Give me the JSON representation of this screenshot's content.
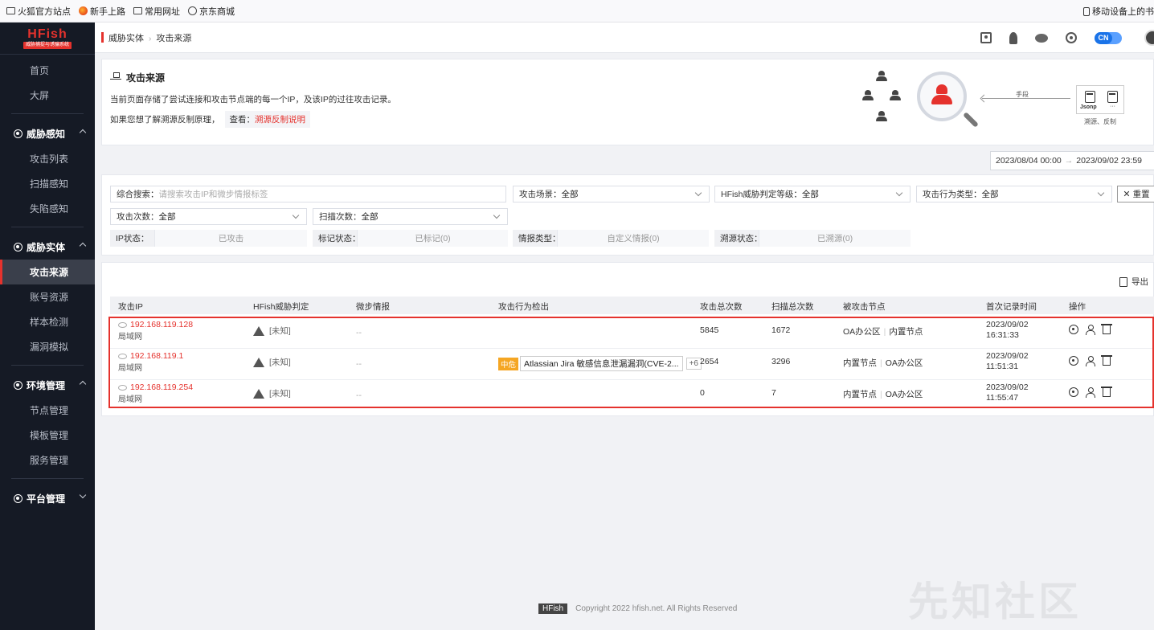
{
  "browser": {
    "bookmarks": [
      {
        "label": "火狐官方站点",
        "icon": "folder-icon"
      },
      {
        "label": "新手上路",
        "icon": "firefox-icon"
      },
      {
        "label": "常用网址",
        "icon": "folder-icon"
      },
      {
        "label": "京东商城",
        "icon": "globe-icon"
      }
    ],
    "mobile_bookmarks": "移动设备上的书"
  },
  "app": {
    "logo_title": "HFish",
    "logo_subtitle": "威胁捕捉与诱骗系统"
  },
  "sidebar": {
    "top_items": [
      {
        "label": "首页"
      },
      {
        "label": "大屏"
      }
    ],
    "groups": [
      {
        "label": "威胁感知",
        "expanded": true,
        "items": [
          {
            "label": "攻击列表"
          },
          {
            "label": "扫描感知"
          },
          {
            "label": "失陷感知"
          }
        ]
      },
      {
        "label": "威胁实体",
        "expanded": true,
        "items": [
          {
            "label": "攻击来源",
            "active": true
          },
          {
            "label": "账号资源"
          },
          {
            "label": "样本检测"
          },
          {
            "label": "漏洞模拟"
          }
        ]
      },
      {
        "label": "环境管理",
        "expanded": true,
        "items": [
          {
            "label": "节点管理"
          },
          {
            "label": "模板管理"
          },
          {
            "label": "服务管理"
          }
        ]
      },
      {
        "label": "平台管理",
        "expanded": false,
        "items": []
      }
    ]
  },
  "header": {
    "breadcrumb": [
      "威胁实体",
      "攻击来源"
    ],
    "lang": "CN",
    "icons": [
      "book-icon",
      "rocket-icon",
      "wechat-icon",
      "shield-icon",
      "avatar"
    ]
  },
  "intro": {
    "title": "攻击来源",
    "description": "当前页面存储了尝试连接和攻击节点端的每一个IP，及该IP的过往攻击记录。",
    "more_prefix": "如果您想了解溯源反制原理，",
    "more_view": "查看：",
    "more_link": "溯源反制说明",
    "illustration": {
      "arrow_label": "手段",
      "method1": "Jsonp",
      "method2": "···",
      "caption": "溯源、反制"
    }
  },
  "daterange": {
    "start": "2023/08/04 00:00",
    "arrow": "→",
    "end": "2023/09/02 23:59"
  },
  "filters": {
    "search": {
      "label": "综合搜索：",
      "placeholder": "请搜索攻击IP和微步情报标签"
    },
    "scene": {
      "label": "攻击场景：",
      "value": "全部"
    },
    "threat_level": {
      "label": "HFish威胁判定等级：",
      "value": "全部"
    },
    "behavior": {
      "label": "攻击行为类型：",
      "value": "全部"
    },
    "reset": "重置",
    "attack_count": {
      "label": "攻击次数：",
      "value": "全部"
    },
    "scan_count": {
      "label": "扫描次数：",
      "value": "全部"
    },
    "ip_state": {
      "label": "IP状态：",
      "value": "已攻击"
    },
    "mark_state": {
      "label": "标记状态：",
      "value": "已标记(0)"
    },
    "intel_type": {
      "label": "情报类型：",
      "value": "自定义情报(0)"
    },
    "trace_state": {
      "label": "溯源状态：",
      "value": "已溯源(0)"
    }
  },
  "table": {
    "export": "导出",
    "columns": [
      "攻击IP",
      "HFish威胁判定",
      "微步情报",
      "攻击行为检出",
      "攻击总次数",
      "扫描总次数",
      "被攻击节点",
      "首次记录时间",
      "操作"
    ],
    "rows": [
      {
        "ip": "192.168.119.128",
        "subnet": "局域网",
        "verdict": "[未知]",
        "intel": "--",
        "behavior_level": "",
        "behavior": "",
        "behavior_more": "",
        "attacks": "5845",
        "scans": "1672",
        "nodes": [
          "OA办公区",
          "内置节点"
        ],
        "date": "2023/09/02",
        "time": "16:31:33"
      },
      {
        "ip": "192.168.119.1",
        "subnet": "局域网",
        "verdict": "[未知]",
        "intel": "--",
        "behavior_level": "中危",
        "behavior": "Atlassian Jira 敏感信息泄漏漏洞(CVE-2...",
        "behavior_more": "+6",
        "attacks": "2654",
        "scans": "3296",
        "nodes": [
          "内置节点",
          "OA办公区"
        ],
        "date": "2023/09/02",
        "time": "11:51:31"
      },
      {
        "ip": "192.168.119.254",
        "subnet": "局域网",
        "verdict": "[未知]",
        "intel": "--",
        "behavior_level": "",
        "behavior": "",
        "behavior_more": "",
        "attacks": "0",
        "scans": "7",
        "nodes": [
          "内置节点",
          "OA办公区"
        ],
        "date": "2023/09/02",
        "time": "11:55:47"
      }
    ]
  },
  "footer": {
    "brand": "HFish",
    "copyright": "Copyright 2022 hfish.net. All Rights Reserved"
  },
  "watermark": "先知社区",
  "colors": {
    "accent": "#e5322d",
    "sidebar_bg": "#151a25",
    "medium_risk": "#f5a623",
    "lang_toggle": "#1a73e8"
  }
}
